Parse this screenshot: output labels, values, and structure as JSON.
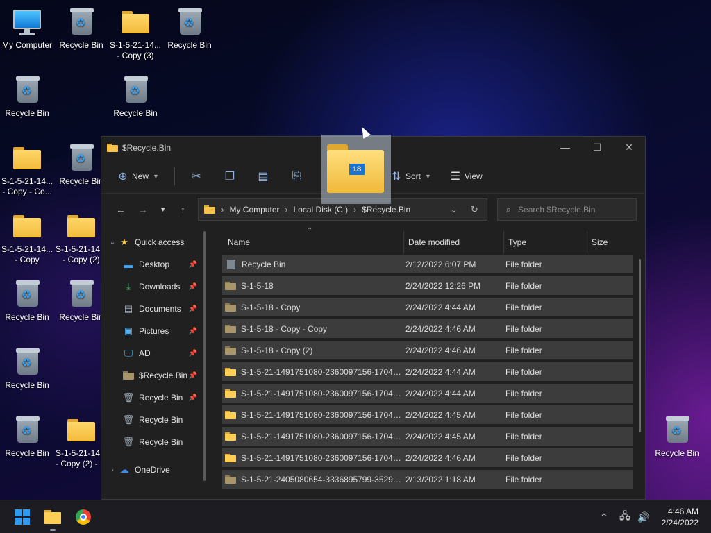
{
  "desktop": {
    "icons": [
      {
        "label": "My Computer",
        "type": "pc"
      },
      {
        "label": "Recycle Bin",
        "type": "bin"
      },
      {
        "label": "S-1-5-21-14... - Copy (3)",
        "type": "folder"
      },
      {
        "label": "Recycle Bin",
        "type": "bin"
      },
      {
        "label": "Recycle Bin",
        "type": "bin"
      },
      {
        "label": "Recycle Bin",
        "type": "bin"
      },
      {
        "label": "S-1-5-21-14... - Copy - Co...",
        "type": "folder"
      },
      {
        "label": "Recycle Bin",
        "type": "bin"
      },
      {
        "label": "S-1-5-21-14... - Copy",
        "type": "folder"
      },
      {
        "label": "S-1-5-21-14... - Copy (2)",
        "type": "folder"
      },
      {
        "label": "Recycle Bin",
        "type": "bin"
      },
      {
        "label": "Recycle Bin",
        "type": "bin"
      },
      {
        "label": "Recycle Bin",
        "type": "bin"
      },
      {
        "label": "Recycle Bin",
        "type": "bin"
      },
      {
        "label": "S-1-5-21-14... - Copy (2) - ...",
        "type": "folder"
      },
      {
        "label": "Recycle Bin",
        "type": "bin"
      }
    ]
  },
  "window": {
    "title": "$Recycle.Bin",
    "controls": {
      "minimize": "—",
      "maximize": "☐",
      "close": "✕"
    }
  },
  "toolbar": {
    "new_label": "New",
    "sort_label": "Sort",
    "view_label": "View"
  },
  "address": {
    "crumbs": [
      "My Computer",
      "Local Disk (C:)",
      "$Recycle.Bin"
    ],
    "separator": "›"
  },
  "search": {
    "placeholder": "Search $Recycle.Bin"
  },
  "navpane": {
    "quick_access": "Quick access",
    "items": [
      {
        "label": "Desktop",
        "icon": "desktop-icon",
        "pinned": true
      },
      {
        "label": "Downloads",
        "icon": "download-icon",
        "pinned": true
      },
      {
        "label": "Documents",
        "icon": "document-icon",
        "pinned": true
      },
      {
        "label": "Pictures",
        "icon": "pictures-icon",
        "pinned": true
      },
      {
        "label": "AD",
        "icon": "monitor-icon",
        "pinned": true
      },
      {
        "label": "$Recycle.Bin",
        "icon": "folder-icon",
        "pinned": true
      },
      {
        "label": "Recycle Bin",
        "icon": "recycle-bin-icon",
        "pinned": true
      },
      {
        "label": "Recycle Bin",
        "icon": "recycle-bin-icon",
        "pinned": false
      },
      {
        "label": "Recycle Bin",
        "icon": "recycle-bin-icon",
        "pinned": false
      }
    ],
    "onedrive": "OneDrive"
  },
  "filelist": {
    "columns": {
      "name": "Name",
      "date": "Date modified",
      "type": "Type",
      "size": "Size"
    },
    "rows": [
      {
        "name": "Recycle Bin",
        "date": "2/12/2022 6:07 PM",
        "type": "File folder",
        "icon": "bin"
      },
      {
        "name": "S-1-5-18",
        "date": "2/24/2022 12:26 PM",
        "type": "File folder",
        "icon": "dim"
      },
      {
        "name": "S-1-5-18 - Copy",
        "date": "2/24/2022 4:44 AM",
        "type": "File folder",
        "icon": "dim"
      },
      {
        "name": "S-1-5-18 - Copy - Copy",
        "date": "2/24/2022 4:46 AM",
        "type": "File folder",
        "icon": "dim"
      },
      {
        "name": "S-1-5-18 - Copy (2)",
        "date": "2/24/2022 4:46 AM",
        "type": "File folder",
        "icon": "dim"
      },
      {
        "name": "S-1-5-21-1491751080-2360097156-170421...",
        "date": "2/24/2022 4:44 AM",
        "type": "File folder",
        "icon": "yellow"
      },
      {
        "name": "S-1-5-21-1491751080-2360097156-170421...",
        "date": "2/24/2022 4:44 AM",
        "type": "File folder",
        "icon": "yellow"
      },
      {
        "name": "S-1-5-21-1491751080-2360097156-170421...",
        "date": "2/24/2022 4:45 AM",
        "type": "File folder",
        "icon": "yellow"
      },
      {
        "name": "S-1-5-21-1491751080-2360097156-170421...",
        "date": "2/24/2022 4:45 AM",
        "type": "File folder",
        "icon": "yellow"
      },
      {
        "name": "S-1-5-21-1491751080-2360097156-170421...",
        "date": "2/24/2022 4:46 AM",
        "type": "File folder",
        "icon": "yellow"
      },
      {
        "name": "S-1-5-21-2405080654-3336895799-352903...",
        "date": "2/13/2022 1:18 AM",
        "type": "File folder",
        "icon": "dim"
      }
    ]
  },
  "drag": {
    "count": "18"
  },
  "taskbar": {
    "time": "4:46 AM",
    "date": "2/24/2022"
  },
  "colors": {
    "accent": "#2d9bf0",
    "folder": "#f5c34c",
    "window_bg": "#202020",
    "row_bg": "#3c3c3c"
  }
}
